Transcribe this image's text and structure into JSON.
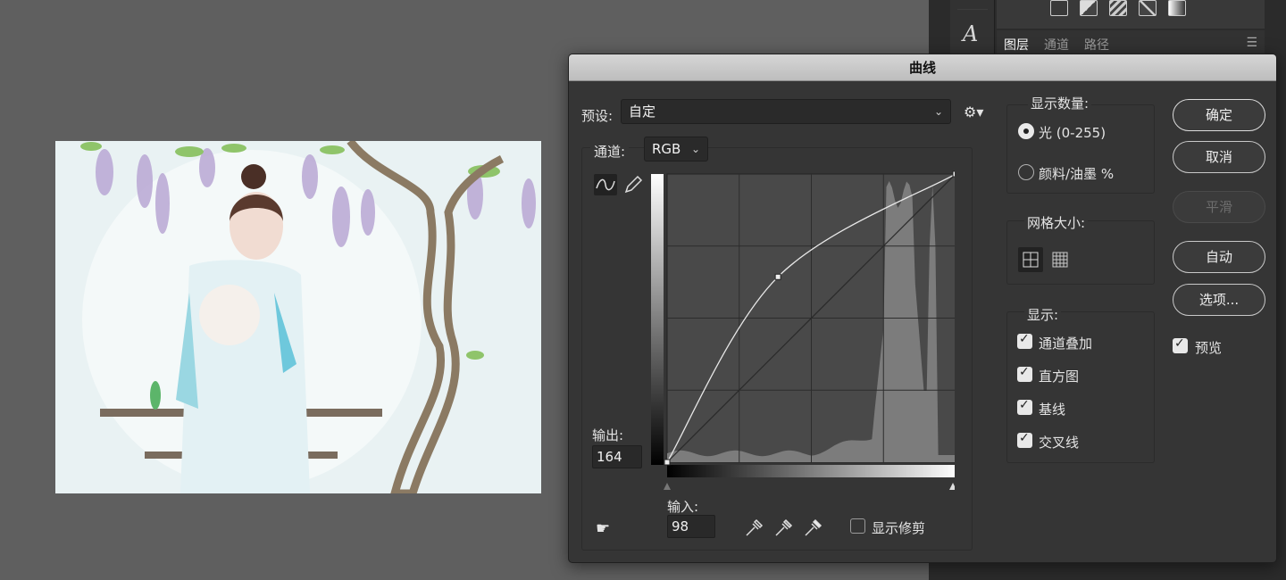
{
  "panel": {
    "tabs": [
      "图层",
      "通道",
      "路径"
    ],
    "type_tool_glyph": "A"
  },
  "dialog": {
    "title": "曲线",
    "preset_label": "预设:",
    "preset_value": "自定",
    "channel_label": "通道:",
    "channel_value": "RGB",
    "output_label": "输出:",
    "output_value": "164",
    "input_label": "输入:",
    "input_value": "98",
    "show_clipping": "显示修剪",
    "display_amount": {
      "title": "显示数量:",
      "options": [
        "光 (0-255)",
        "颜料/油墨 %"
      ],
      "selected": 0
    },
    "grid_size": {
      "title": "网格大小:"
    },
    "show": {
      "title": "显示:",
      "options": [
        "通道叠加",
        "直方图",
        "基线",
        "交叉线"
      ]
    },
    "buttons": {
      "ok": "确定",
      "cancel": "取消",
      "smooth": "平滑",
      "auto": "自动",
      "options": "选项..."
    },
    "preview": "预览"
  },
  "curve": {
    "control_points": [
      [
        0,
        0
      ],
      [
        98,
        164
      ],
      [
        255,
        255
      ]
    ],
    "input_range": [
      0,
      255
    ],
    "output_range": [
      0,
      255
    ]
  },
  "colors": {
    "dialog_bg": "#353535",
    "graph_bg": "#4a4a4a",
    "histogram": "#7c7c7c"
  }
}
